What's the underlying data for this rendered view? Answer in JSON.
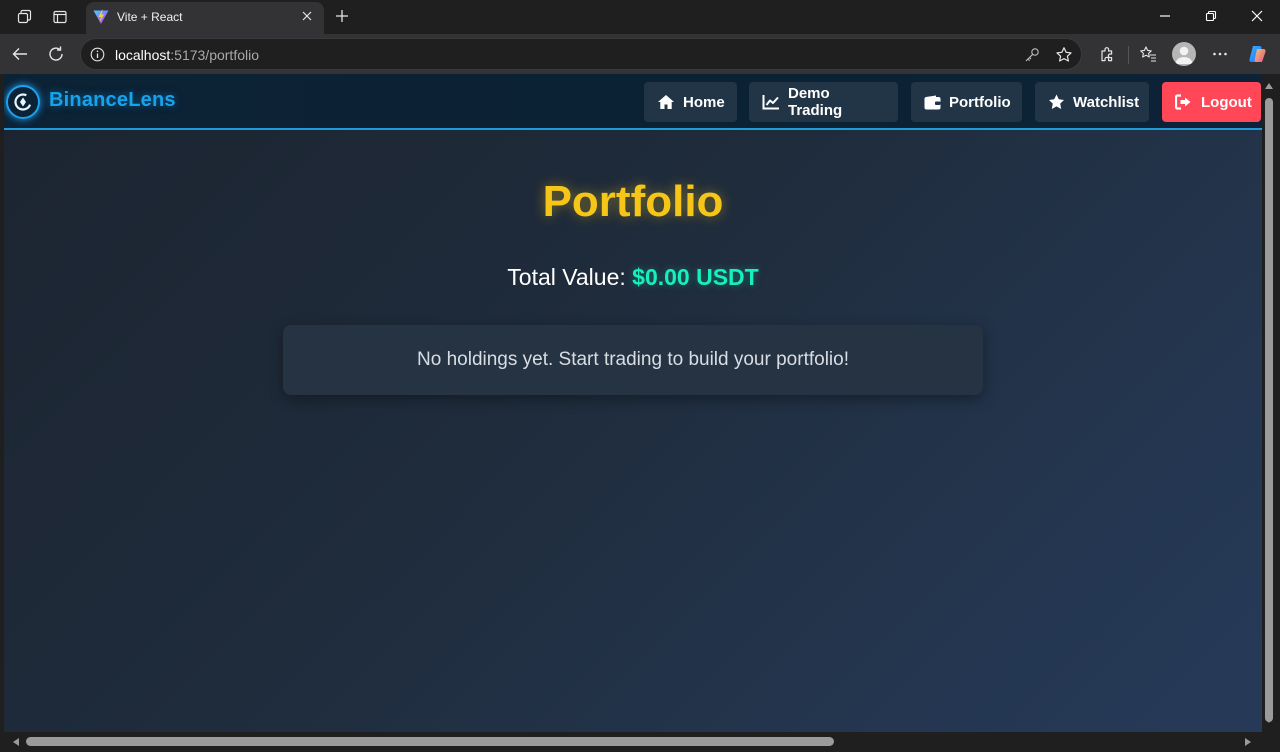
{
  "browser": {
    "tab_title": "Vite + React",
    "url_host": "localhost",
    "url_rest": ":5173/portfolio"
  },
  "app": {
    "brand": "BinanceLens",
    "nav": {
      "home": "Home",
      "demo_trading": "Demo Trading",
      "portfolio": "Portfolio",
      "watchlist": "Watchlist",
      "logout": "Logout"
    },
    "colors": {
      "accent_blue": "#16a3ee",
      "title_gold": "#f5c518",
      "value_teal": "#15f0bd",
      "logout_red": "#ff4757"
    }
  },
  "portfolio": {
    "title": "Portfolio",
    "total_label": "Total Value: ",
    "total_amount": "$0.00 USDT",
    "empty_message": "No holdings yet. Start trading to build your portfolio!"
  },
  "icons": {
    "workspaces": "workspaces-icon",
    "tab_actions": "tab-actions-icon",
    "back": "back-arrow-icon",
    "reload": "reload-icon",
    "site_info": "info-icon",
    "key": "key-icon",
    "favorite": "star-outline-icon",
    "extensions": "puzzle-icon",
    "favorites_list": "favorites-list-icon",
    "more": "ellipsis-icon",
    "copilot": "copilot-icon",
    "home": "home-icon",
    "chart": "chart-line-icon",
    "wallet": "wallet-icon",
    "watchlist": "star-icon",
    "logout": "logout-icon"
  }
}
